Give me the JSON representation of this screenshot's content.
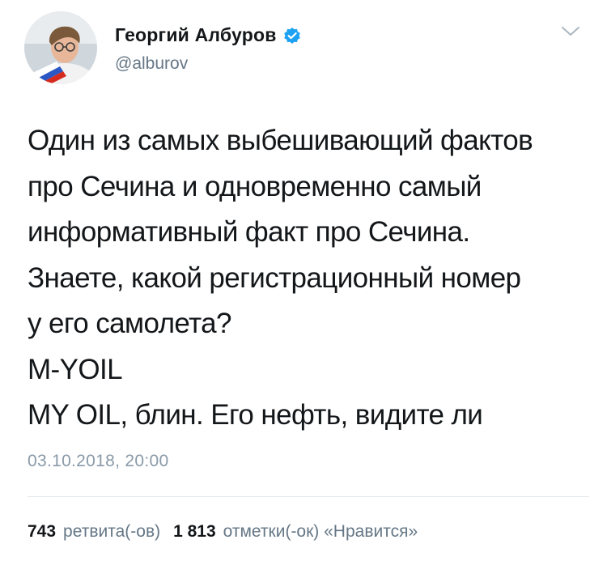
{
  "author": {
    "display_name": "Георгий Албуров",
    "handle": "@alburov"
  },
  "icons": {
    "avatar": "avatar-photo",
    "verified": "verified-badge-icon",
    "menu": "chevron-down-icon"
  },
  "colors": {
    "verified": "#1da1f2",
    "text": "#14171a",
    "secondary": "#657786"
  },
  "tweet": {
    "lines": [
      "Один из самых выбешивающий фактов",
      "про Сечина и одновременно самый",
      "информативный факт про Сечина.",
      "Знаете, какой регистрационный номер",
      "у его самолета?",
      "M-YOIL",
      "MY OIL, блин. Его нефть, видите ли"
    ],
    "timestamp": "03.10.2018, 20:00"
  },
  "stats": {
    "retweets_count": "743",
    "retweets_label": "ретвита(-ов)",
    "likes_count": "1 813",
    "likes_label": "отметки(-ок) «Нравится»"
  }
}
